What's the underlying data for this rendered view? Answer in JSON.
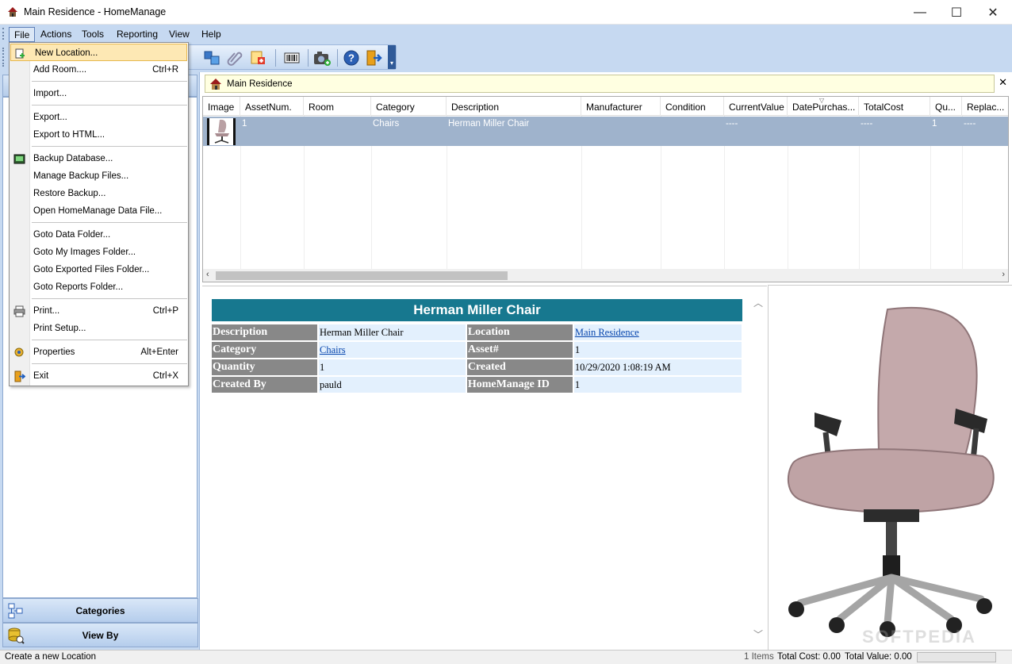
{
  "window": {
    "title": "Main Residence - HomeManage",
    "minimize": "—",
    "maximize": "☐",
    "close": "✕"
  },
  "menubar": {
    "items": [
      "File",
      "Actions",
      "Tools",
      "Reporting",
      "View",
      "Help"
    ],
    "active": "File"
  },
  "file_menu": {
    "items": [
      {
        "label": "New Location...",
        "shortcut": ""
      },
      {
        "label": "Add Room....",
        "shortcut": "Ctrl+R"
      },
      {
        "label": "Import...",
        "shortcut": ""
      },
      {
        "label": "Export...",
        "shortcut": ""
      },
      {
        "label": "Export to HTML...",
        "shortcut": ""
      },
      {
        "label": "Backup Database...",
        "shortcut": ""
      },
      {
        "label": "Manage Backup Files...",
        "shortcut": ""
      },
      {
        "label": "Restore Backup...",
        "shortcut": ""
      },
      {
        "label": "Open HomeManage Data File...",
        "shortcut": ""
      },
      {
        "label": "Goto Data Folder...",
        "shortcut": ""
      },
      {
        "label": "Goto My Images Folder...",
        "shortcut": ""
      },
      {
        "label": "Goto Exported Files Folder...",
        "shortcut": ""
      },
      {
        "label": "Goto Reports Folder...",
        "shortcut": ""
      },
      {
        "label": "Print...",
        "shortcut": "Ctrl+P"
      },
      {
        "label": "Print Setup...",
        "shortcut": ""
      },
      {
        "label": "Properties",
        "shortcut": "Alt+Enter"
      },
      {
        "label": "Exit",
        "shortcut": "Ctrl+X"
      }
    ]
  },
  "breadcrumb": {
    "text": "Main Residence",
    "close": "✕"
  },
  "grid": {
    "columns": [
      "Image",
      "AssetNum.",
      "Room",
      "Category",
      "Description",
      "Manufacturer",
      "Condition",
      "CurrentValue",
      "DatePurchas...",
      "TotalCost",
      "Qu...",
      "Replac..."
    ],
    "rows": [
      {
        "asset_num": "1",
        "room": "",
        "category": "Chairs",
        "description": "Herman Miller Chair",
        "manufacturer": "",
        "condition": "",
        "current_value": "----",
        "date_purchased": "",
        "total_cost": "----",
        "quantity": "1",
        "replacement": "----"
      }
    ]
  },
  "detail": {
    "title": "Herman Miller Chair",
    "rows": [
      {
        "k1": "Description",
        "v1": "Herman Miller Chair",
        "k2": "Location",
        "v2": "Main Residence"
      },
      {
        "k1": "Category",
        "v1": "Chairs",
        "k2": "Asset#",
        "v2": "1"
      },
      {
        "k1": "Quantity",
        "v1": "1",
        "k2": "Created",
        "v2": "10/29/2020 1:08:19 AM"
      },
      {
        "k1": "Created By",
        "v1": "pauld",
        "k2": "HomeManage ID",
        "v2": "1"
      }
    ]
  },
  "nav": {
    "categories": "Categories",
    "view_by": "View By"
  },
  "status": {
    "message": "Create a new Location",
    "items": "1 Items",
    "total_cost": "Total Cost: 0.00",
    "total_value": "Total Value: 0.00"
  },
  "watermark": "SOFTPEDIA",
  "colors": {
    "accent": "#17788f",
    "selection": "#9fb3cc",
    "menu_highlight": "#fde8b4",
    "chrome": "#c6d9f1"
  }
}
